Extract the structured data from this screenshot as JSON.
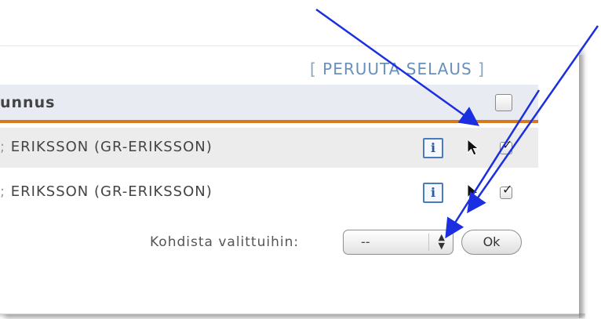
{
  "cancel_link": {
    "open_bracket": "[",
    "label": "PERUUTA SELAUS",
    "close_bracket": "]"
  },
  "table": {
    "header_label": "unnus",
    "rows": [
      {
        "name": "ERIKSSON (GR-ERIKSSON)",
        "info_label": "i",
        "checked": true
      },
      {
        "name": "ERIKSSON (GR-ERIKSSON)",
        "info_label": "i",
        "checked": true
      }
    ]
  },
  "footer": {
    "bulk_action_label": "Kohdista valittuihin:",
    "bulk_action_selected": "--",
    "ok_label": "Ok"
  },
  "colors": {
    "arrow": "#1b2fe0",
    "accent_border": "#d9781f",
    "link": "#6a8fb8"
  }
}
